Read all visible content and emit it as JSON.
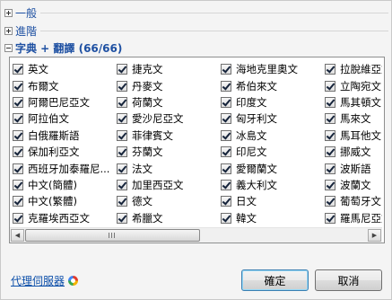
{
  "sections": [
    {
      "label": "一般",
      "expanded": false
    },
    {
      "label": "進階",
      "expanded": false
    },
    {
      "label": "字典 + 翻譯 (66/66)",
      "expanded": true
    }
  ],
  "dictionaries": [
    {
      "label": "英文",
      "checked": true
    },
    {
      "label": "布爾文",
      "checked": true
    },
    {
      "label": "阿爾巴尼亞文",
      "checked": true
    },
    {
      "label": "阿拉伯文",
      "checked": true
    },
    {
      "label": "白俄羅斯語",
      "checked": true
    },
    {
      "label": "保加利亞文",
      "checked": true
    },
    {
      "label": "西班牙加泰羅尼...",
      "checked": true
    },
    {
      "label": "中文(簡體)",
      "checked": true
    },
    {
      "label": "中文(繁體)",
      "checked": true
    },
    {
      "label": "克羅埃西亞文",
      "checked": true
    },
    {
      "label": "捷克文",
      "checked": true
    },
    {
      "label": "丹麥文",
      "checked": true
    },
    {
      "label": "荷蘭文",
      "checked": true
    },
    {
      "label": "愛沙尼亞文",
      "checked": true
    },
    {
      "label": "菲律賓文",
      "checked": true
    },
    {
      "label": "芬蘭文",
      "checked": true
    },
    {
      "label": "法文",
      "checked": true
    },
    {
      "label": "加里西亞文",
      "checked": true
    },
    {
      "label": "德文",
      "checked": true
    },
    {
      "label": "希臘文",
      "checked": true
    },
    {
      "label": "海地克里奧文",
      "checked": true
    },
    {
      "label": "希伯來文",
      "checked": true
    },
    {
      "label": "印度文",
      "checked": true
    },
    {
      "label": "匈牙利文",
      "checked": true
    },
    {
      "label": "冰島文",
      "checked": true
    },
    {
      "label": "印尼文",
      "checked": true
    },
    {
      "label": "愛爾蘭文",
      "checked": true
    },
    {
      "label": "義大利文",
      "checked": true
    },
    {
      "label": "日文",
      "checked": true
    },
    {
      "label": "韓文",
      "checked": true
    },
    {
      "label": "拉脫維亞文",
      "checked": true
    },
    {
      "label": "立陶宛文",
      "checked": true
    },
    {
      "label": "馬其頓文",
      "checked": true
    },
    {
      "label": "馬來文",
      "checked": true
    },
    {
      "label": "馬耳他文",
      "checked": true
    },
    {
      "label": "挪威文",
      "checked": true
    },
    {
      "label": "波斯語",
      "checked": true
    },
    {
      "label": "波蘭文",
      "checked": true
    },
    {
      "label": "葡萄牙文",
      "checked": true
    },
    {
      "label": "羅馬尼亞文",
      "checked": true
    }
  ],
  "footer": {
    "proxy_link": "代理伺服器",
    "ok_label": "確定",
    "cancel_label": "取消"
  },
  "icons": {
    "scroll_left": "scroll-left-icon",
    "scroll_right": "scroll-right-icon",
    "proxy": "proxy-icon"
  }
}
